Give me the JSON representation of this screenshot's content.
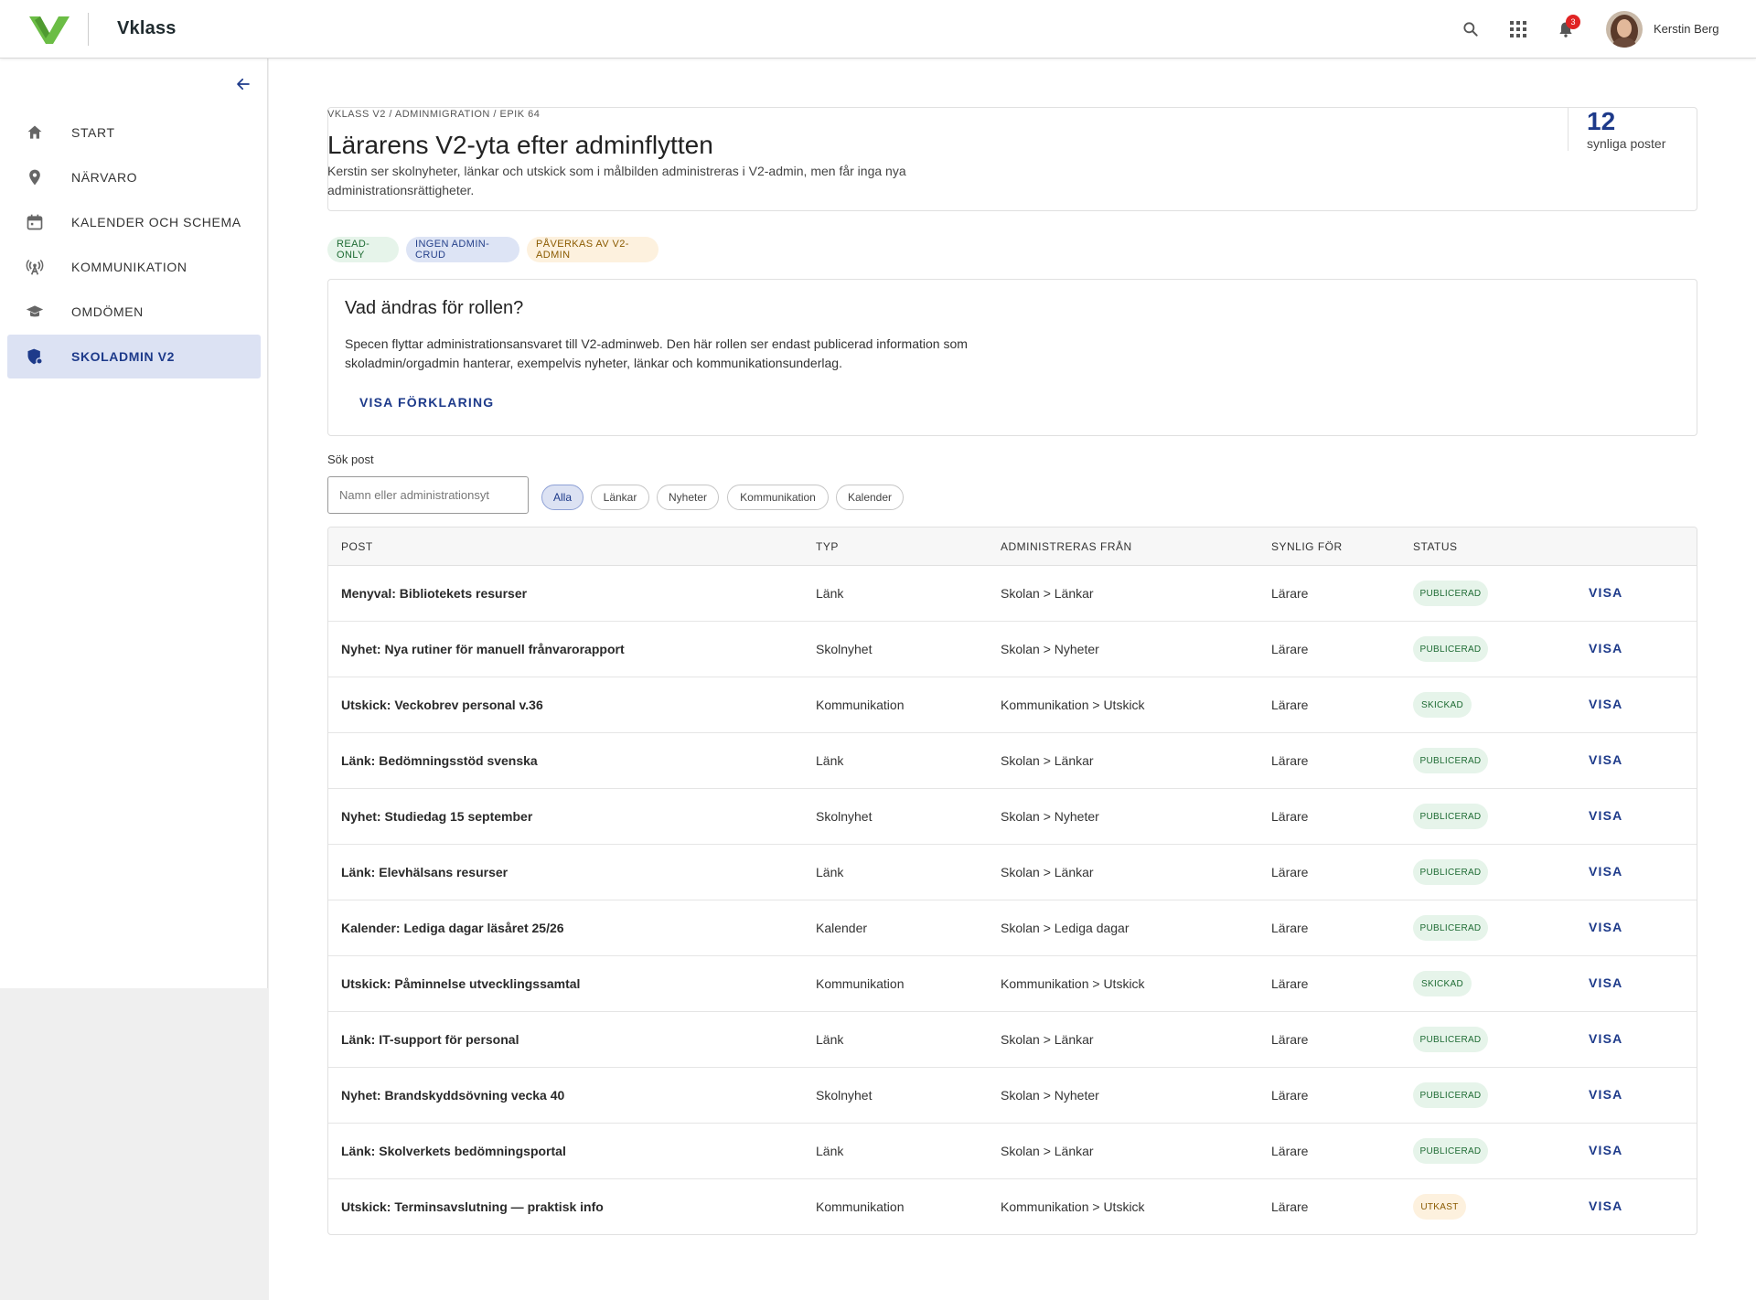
{
  "header": {
    "brand": "Vklass",
    "user_name": "Kerstin Berg",
    "notification_count": "3",
    "icons": [
      "search-icon",
      "apps-grid-icon",
      "bell-icon"
    ],
    "accent_color": "#1d3a8a",
    "logo_color": "#6bbd45"
  },
  "sidebar": {
    "items": [
      {
        "label": "START",
        "icon": "home-icon"
      },
      {
        "label": "NÄRVARO",
        "icon": "location-pin-icon"
      },
      {
        "label": "KALENDER OCH SCHEMA",
        "icon": "calendar-icon"
      },
      {
        "label": "KOMMUNIKATION",
        "icon": "broadcast-icon"
      },
      {
        "label": "OMDÖMEN",
        "icon": "graduation-cap-icon"
      },
      {
        "label": "SKOLADMIN V2",
        "icon": "shield-admin-icon",
        "active": true
      }
    ]
  },
  "intro": {
    "breadcrumb": "VKLASS V2 / ADMINMIGRATION / EPIK 64",
    "title": "Lärarens V2-yta efter adminflytten",
    "description": "Kerstin ser skolnyheter, länkar och utskick som i målbilden administreras i V2-admin, men får inga nya administrationsrättigheter.",
    "count": "12",
    "count_label": "synliga poster"
  },
  "chips": [
    "READ-ONLY",
    "INGEN ADMIN-CRUD",
    "PÅVERKAS AV V2-ADMIN"
  ],
  "info": {
    "title": "Vad ändras för rollen?",
    "text": "Specen flyttar administrationsansvaret till V2-adminweb. Den här rollen ser endast publicerad information som skoladmin/orgadmin hanterar, exempelvis nyheter, länkar och kommunikationsunderlag.",
    "button": "VISA FÖRKLARING"
  },
  "search": {
    "label": "Sök post",
    "placeholder": "Namn eller administrationsyt",
    "value": ""
  },
  "filters": [
    "Alla",
    "Länkar",
    "Nyheter",
    "Kommunikation",
    "Kalender"
  ],
  "table": {
    "headers": [
      "POST",
      "TYP",
      "ADMINISTRERAS FRÅN",
      "SYNLIG FÖR",
      "STATUS"
    ],
    "action_label": "VISA",
    "rows": [
      {
        "post": "Menyval: Bibliotekets resurser",
        "typ": "Länk",
        "from": "Skolan > Länkar",
        "for": "Lärare",
        "status": "PUBLICERAD"
      },
      {
        "post": "Nyhet: Nya rutiner för manuell frånvarorapport",
        "typ": "Skolnyhet",
        "from": "Skolan > Nyheter",
        "for": "Lärare",
        "status": "PUBLICERAD"
      },
      {
        "post": "Utskick: Veckobrev personal v.36",
        "typ": "Kommunikation",
        "from": "Kommunikation > Utskick",
        "for": "Lärare",
        "status": "SKICKAD"
      },
      {
        "post": "Länk: Bedömningsstöd svenska",
        "typ": "Länk",
        "from": "Skolan > Länkar",
        "for": "Lärare",
        "status": "PUBLICERAD"
      },
      {
        "post": "Nyhet: Studiedag 15 september",
        "typ": "Skolnyhet",
        "from": "Skolan > Nyheter",
        "for": "Lärare",
        "status": "PUBLICERAD"
      },
      {
        "post": "Länk: Elevhälsans resurser",
        "typ": "Länk",
        "from": "Skolan > Länkar",
        "for": "Lärare",
        "status": "PUBLICERAD"
      },
      {
        "post": "Kalender: Lediga dagar läsåret 25/26",
        "typ": "Kalender",
        "from": "Skolan > Lediga dagar",
        "for": "Lärare",
        "status": "PUBLICERAD"
      },
      {
        "post": "Utskick: Påminnelse utvecklingssamtal",
        "typ": "Kommunikation",
        "from": "Kommunikation > Utskick",
        "for": "Lärare",
        "status": "SKICKAD"
      },
      {
        "post": "Länk: IT-support för personal",
        "typ": "Länk",
        "from": "Skolan > Länkar",
        "for": "Lärare",
        "status": "PUBLICERAD"
      },
      {
        "post": "Nyhet: Brandskyddsövning vecka 40",
        "typ": "Skolnyhet",
        "from": "Skolan > Nyheter",
        "for": "Lärare",
        "status": "PUBLICERAD"
      },
      {
        "post": "Länk: Skolverkets bedömningsportal",
        "typ": "Länk",
        "from": "Skolan > Länkar",
        "for": "Lärare",
        "status": "PUBLICERAD"
      },
      {
        "post": "Utskick: Terminsavslutning — praktisk info",
        "typ": "Kommunikation",
        "from": "Kommunikation > Utskick",
        "for": "Lärare",
        "status": "UTKAST"
      }
    ]
  }
}
